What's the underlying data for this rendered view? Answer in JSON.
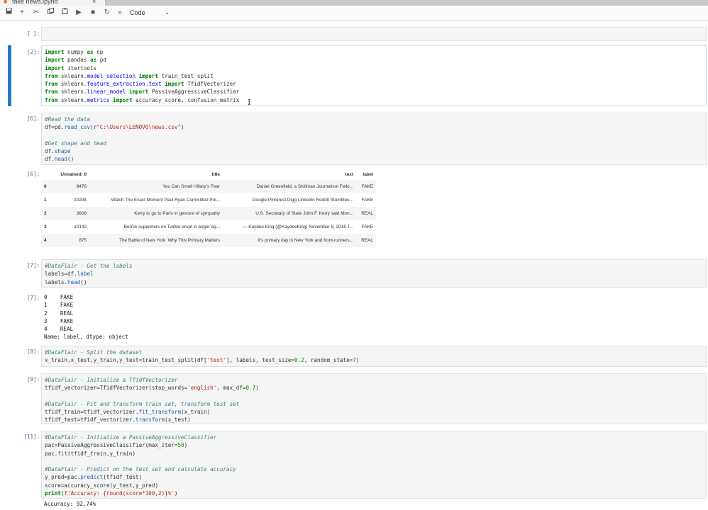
{
  "tab": {
    "label": "fake news.ipynb",
    "close": "×"
  },
  "toolbar": {
    "buttons": [
      "save",
      "add",
      "cut",
      "copy",
      "paste",
      "run",
      "stop",
      "restart",
      "fast-forward"
    ],
    "cell_type": "Code"
  },
  "cells": [
    {
      "prompt": "[ ]:",
      "lines": []
    },
    {
      "prompt": "[2]:",
      "lines": [
        "import numpy as np",
        "import pandas as pd",
        "import itertools",
        "from sklearn.model_selection import train_test_split",
        "from sklearn.feature_extraction.text import TfidfVectorizer",
        "from sklearn.linear_model import PassiveAggressiveClassifier",
        "from sklearn.metrics import accuracy_score, confusion_matrix"
      ]
    },
    {
      "prompt": "[6]:",
      "lines": [
        "#Read the data",
        "df=pd.read_csv(r\"C:\\Users\\LENOVO\\news.csv\")",
        "",
        "#Get shape and head",
        "df.shape",
        "df.head()"
      ]
    },
    {
      "prompt": "[7]:",
      "lines": [
        "#DataFlair - Get the labels",
        "labels=df.label",
        "labels.head()"
      ]
    },
    {
      "prompt": "[8]:",
      "lines": [
        "#DataFlair - Split the dataset",
        "x_train,x_test,y_train,y_test=train_test_split(df['text'], labels, test_size=0.2, random_state=7)"
      ]
    },
    {
      "prompt": "[9]:",
      "lines": [
        "#DataFlair - Initialize a TfidfVectorizer",
        "tfidf_vectorizer=TfidfVectorizer(stop_words='english', max_df=0.7)",
        "",
        "#DataFlair - Fit and transform train set, transform test set",
        "tfidf_train=tfidf_vectorizer.fit_transform(x_train)",
        "tfidf_test=tfidf_vectorizer.transform(x_test)"
      ]
    },
    {
      "prompt": "[11]:",
      "lines": [
        "#DataFlair - Initialize a PassiveAggressiveClassifier",
        "pac=PassiveAggressiveClassifier(max_iter=50)",
        "pac.fit(tfidf_train,y_train)",
        "",
        "#DataFlair - Predict on the test set and calculate accuracy",
        "y_pred=pac.predict(tfidf_test)",
        "score=accuracy_score(y_test,y_pred)",
        "print(f'Accuracy: {round(score*100,2)}%')"
      ]
    }
  ],
  "outputs": {
    "df_prompt": "[6]:",
    "df_table": {
      "columns": [
        "",
        "Unnamed: 0",
        "title",
        "text",
        "label"
      ],
      "rows": [
        [
          "0",
          "8476",
          "You Can Smell Hillary's Fear",
          "Daniel Greenfield, a Shillman Journalism Fello...",
          "FAKE"
        ],
        [
          "1",
          "10294",
          "Watch The Exact Moment Paul Ryan Committed Pol...",
          "Google Pinterest Digg Linkedin Reddit Stumbleu...",
          "FAKE"
        ],
        [
          "2",
          "3608",
          "Kerry to go to Paris in gesture of sympathy",
          "U.S. Secretary of State John F. Kerry said Mon...",
          "REAL"
        ],
        [
          "3",
          "10142",
          "Bernie supporters on Twitter erupt in anger ag...",
          "— Kaydee King (@KaydeeKing) November 9, 2016 T...",
          "FAKE"
        ],
        [
          "4",
          "875",
          "The Battle of New York: Why This Primary Matters",
          "It's primary day in New York and front-runners...",
          "REAL"
        ]
      ]
    },
    "labels_prompt": "[7]:",
    "labels_lines": [
      "0    FAKE",
      "1    FAKE",
      "2    REAL",
      "3    FAKE",
      "4    REAL",
      "Name: label, dtype: object"
    ],
    "accuracy": "Accuracy: 92.74%"
  }
}
